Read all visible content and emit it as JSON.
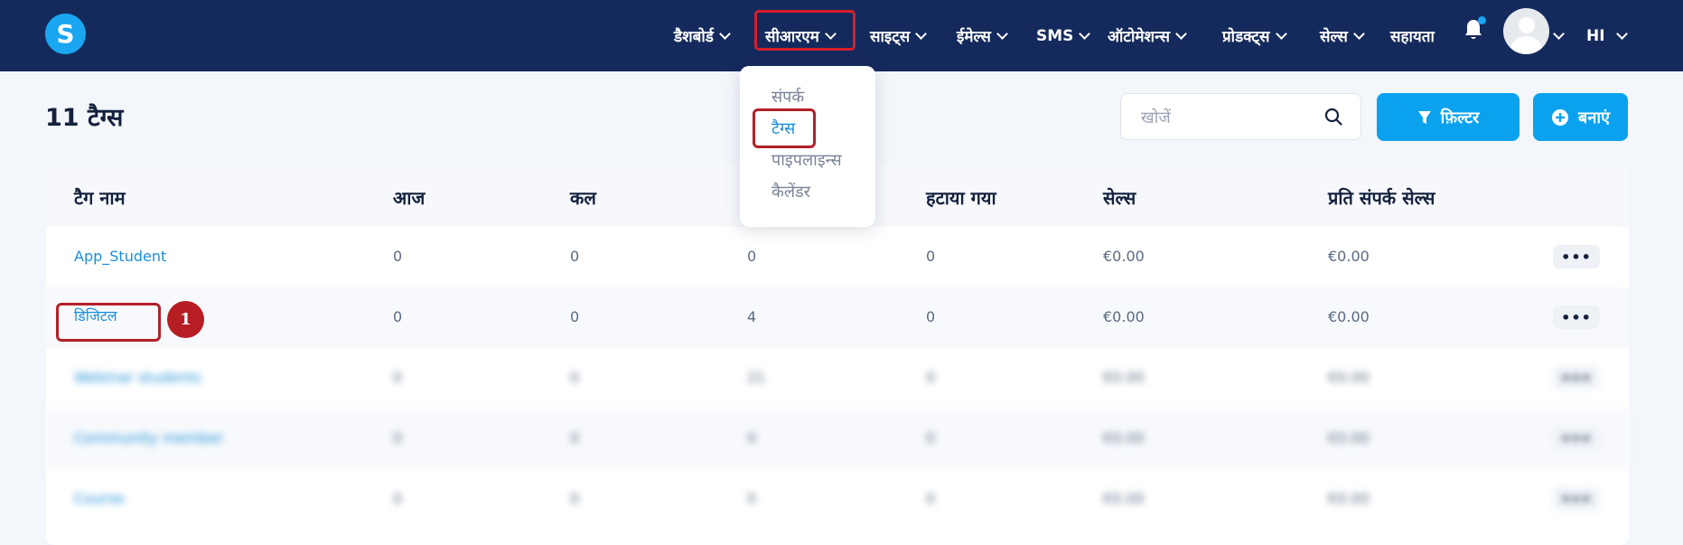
{
  "app": {
    "logo_letter": "S"
  },
  "nav": {
    "items": [
      {
        "label": "डैशबोर्ड",
        "has_dropdown": true
      },
      {
        "label": "सीआरएम",
        "has_dropdown": true,
        "active": true
      },
      {
        "label": "साइट्स",
        "has_dropdown": true
      },
      {
        "label": "ईमेल्स",
        "has_dropdown": true
      },
      {
        "label": "SMS",
        "has_dropdown": true
      },
      {
        "label": "ऑटोमेशन्स",
        "has_dropdown": true
      },
      {
        "label": "प्रोडक्ट्स",
        "has_dropdown": true
      },
      {
        "label": "सेल्स",
        "has_dropdown": true
      },
      {
        "label": "सहायता",
        "has_dropdown": false
      }
    ],
    "language": "HI"
  },
  "crm_menu": {
    "items": [
      {
        "label": "संपर्क",
        "active": false
      },
      {
        "label": "टैग्स",
        "active": true
      },
      {
        "label": "पाइपलाइन्स",
        "active": false
      },
      {
        "label": "कैलेंडर",
        "active": false
      }
    ]
  },
  "page": {
    "title": "11 टैग्स",
    "search_placeholder": "खोजें",
    "filter_label": "फ़िल्टर",
    "create_label": "बनाएं"
  },
  "table": {
    "headers": [
      "टैग नाम",
      "आज",
      "कल",
      "",
      "हटाया गया",
      "सेल्स",
      "प्रति संपर्क सेल्स"
    ],
    "rows": [
      {
        "name": "App_Student",
        "today": "0",
        "yesterday": "0",
        "total": "0",
        "removed": "0",
        "sales": "€0.00",
        "per_contact": "€0.00",
        "more": "•••"
      },
      {
        "name": "डिजिटल",
        "today": "0",
        "yesterday": "0",
        "total": "4",
        "removed": "0",
        "sales": "€0.00",
        "per_contact": "€0.00",
        "more": "•••"
      },
      {
        "name": "Webinar students",
        "today": "0",
        "yesterday": "0",
        "total": "21",
        "removed": "0",
        "sales": "€0.00",
        "per_contact": "€0.00",
        "more": "•••"
      },
      {
        "name": "Community member",
        "today": "0",
        "yesterday": "0",
        "total": "0",
        "removed": "0",
        "sales": "€0.00",
        "per_contact": "€0.00",
        "more": "•••"
      },
      {
        "name": "Course",
        "today": "0",
        "yesterday": "0",
        "total": "0",
        "removed": "0",
        "sales": "€0.00",
        "per_contact": "€0.00",
        "more": "•••"
      }
    ]
  },
  "annotation": {
    "step": "1"
  },
  "colors": {
    "nav_bg": "#152a5c",
    "accent": "#0aa2ef",
    "highlight": "#b32028"
  }
}
